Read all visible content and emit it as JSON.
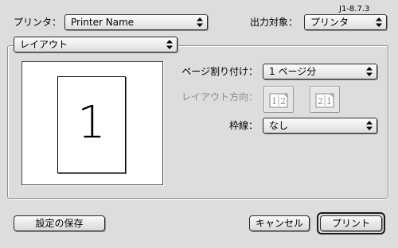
{
  "version": "J1-8.7.3",
  "printer": {
    "label": "プリンタ：",
    "value": "Printer Name"
  },
  "destination": {
    "label": "出力対象：",
    "value": "プリンタ"
  },
  "panel": {
    "value": "レイアウト"
  },
  "preview": {
    "page_number": "1"
  },
  "pages_per_sheet": {
    "label": "ページ割り付け：",
    "value": "1 ページ分"
  },
  "layout_direction": {
    "label": "レイアウト方向：",
    "options": [
      {
        "icon": "left-to-right-icon",
        "glyphs": "12"
      },
      {
        "icon": "right-to-left-icon",
        "glyphs": "21"
      }
    ]
  },
  "border": {
    "label": "枠線：",
    "value": "なし"
  },
  "buttons": {
    "save_settings": "設定の保存",
    "cancel": "キャンセル",
    "print": "プリント"
  }
}
